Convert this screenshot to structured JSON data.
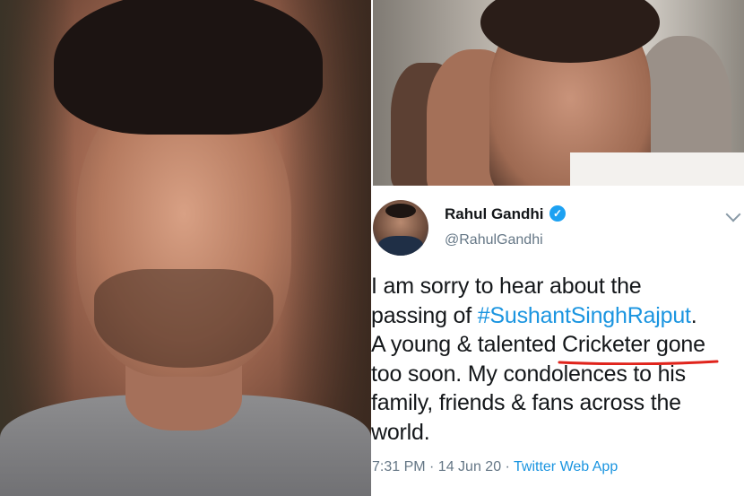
{
  "tweet": {
    "name": "Rahul Gandhi",
    "handle": "@RahulGandhi",
    "lines": [
      "I am sorry to hear about the",
      "passing of ",
      "A young & talented Cricketer gone",
      "too soon. My condolences to his",
      "family, friends & fans across the",
      "world."
    ],
    "hashtag": "#SushantSinghRajput",
    "hashtag_suffix": ".",
    "timestamp": "7:31 PM · 14 Jun 20 · ",
    "source_app": "Twitter Web App"
  },
  "icons": {
    "verified": "verified-badge-icon",
    "chevron": "chevron-down-icon",
    "verified_mark": "✓"
  },
  "colors": {
    "link": "#1b95e0",
    "verified": "#1da1f2",
    "underline": "#e0241c"
  }
}
